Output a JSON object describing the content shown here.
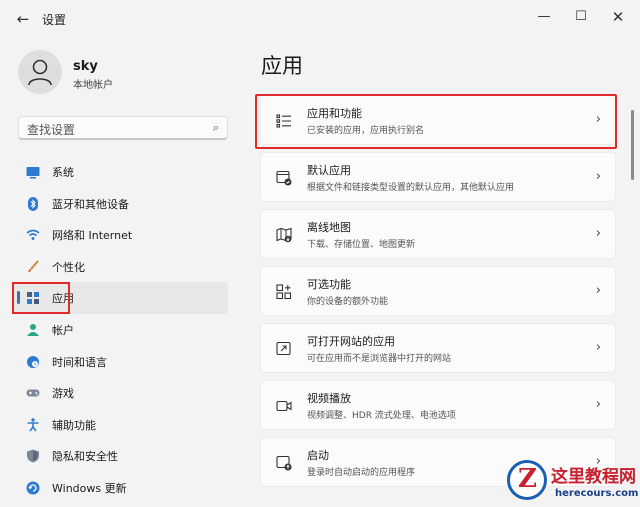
{
  "window": {
    "title": "设置",
    "back_icon": "←",
    "min_icon": "—",
    "max_icon": "☐",
    "close_icon": "✕"
  },
  "profile": {
    "name": "sky",
    "account_type": "本地帐户"
  },
  "search": {
    "placeholder": "查找设置",
    "icon": "⌕"
  },
  "sidebar": {
    "selected": "应用",
    "items": [
      {
        "label": "系统",
        "icon": "monitor-icon"
      },
      {
        "label": "蓝牙和其他设备",
        "icon": "bluetooth-icon"
      },
      {
        "label": "网络和 Internet",
        "icon": "wifi-icon"
      },
      {
        "label": "个性化",
        "icon": "brush-icon"
      },
      {
        "label": "应用",
        "icon": "apps-icon"
      },
      {
        "label": "帐户",
        "icon": "person-icon"
      },
      {
        "label": "时间和语言",
        "icon": "globe-clock-icon"
      },
      {
        "label": "游戏",
        "icon": "gamepad-icon"
      },
      {
        "label": "辅助功能",
        "icon": "accessibility-icon"
      },
      {
        "label": "隐私和安全性",
        "icon": "shield-icon"
      },
      {
        "label": "Windows 更新",
        "icon": "update-icon"
      }
    ]
  },
  "main": {
    "title": "应用",
    "chevron": "›",
    "cards": [
      {
        "title": "应用和功能",
        "subtitle": "已安装的应用，应用执行别名",
        "icon": "list-icon"
      },
      {
        "title": "默认应用",
        "subtitle": "根据文件和链接类型设置的默认应用，其他默认应用",
        "icon": "default-app-icon"
      },
      {
        "title": "离线地图",
        "subtitle": "下载、存储位置、地图更新",
        "icon": "map-icon"
      },
      {
        "title": "可选功能",
        "subtitle": "你的设备的额外功能",
        "icon": "add-grid-icon"
      },
      {
        "title": "可打开网站的应用",
        "subtitle": "可在应用而不是浏览器中打开的网站",
        "icon": "open-link-icon"
      },
      {
        "title": "视频播放",
        "subtitle": "视频调整、HDR 流式处理、电池选项",
        "icon": "video-icon"
      },
      {
        "title": "启动",
        "subtitle": "登录时自动启动的应用程序",
        "icon": "startup-icon"
      }
    ]
  },
  "watermark": {
    "logo_letter": "Z",
    "title": "这里教程网",
    "url": "herecours.com"
  },
  "colors": {
    "accent": "#3a6fb4",
    "highlight": "#e02a2a",
    "background": "#f3f3f3",
    "card": "#fbfbfb"
  }
}
